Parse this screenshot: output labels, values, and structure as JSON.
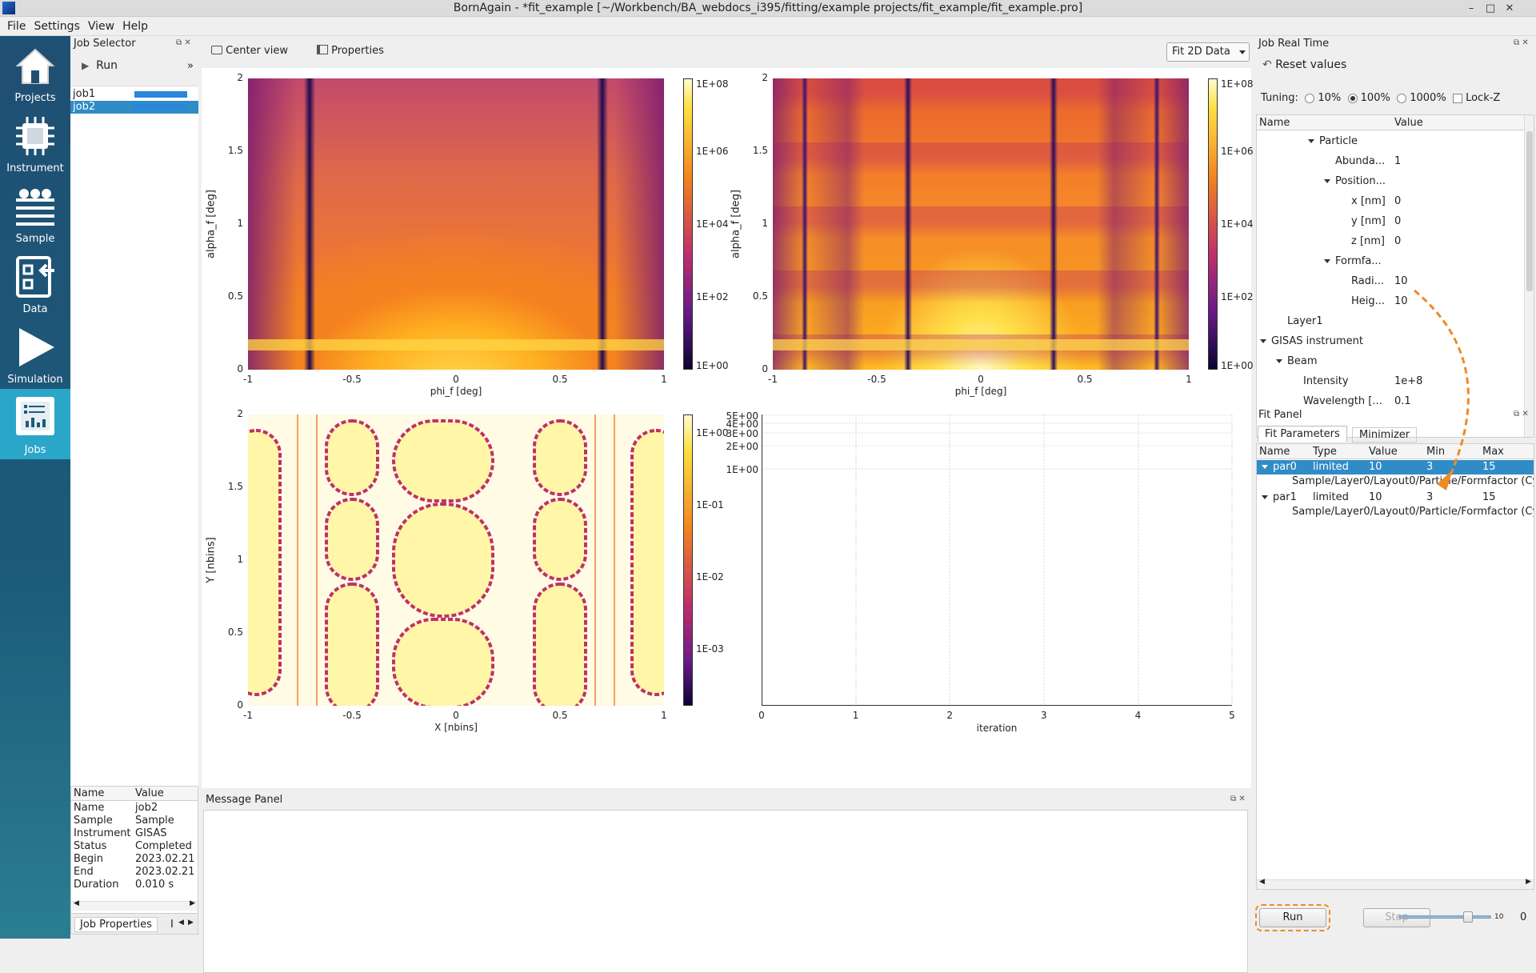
{
  "window": {
    "title": "BornAgain - *fit_example [~/Workbench/BA_webdocs_i395/fitting/example projects/fit_example/fit_example.pro]",
    "min": "–",
    "max": "□",
    "close": "✕"
  },
  "menu": [
    "File",
    "Settings",
    "View",
    "Help"
  ],
  "nav": [
    {
      "label": "Projects",
      "icon": "house-icon"
    },
    {
      "label": "Instrument",
      "icon": "chip-icon"
    },
    {
      "label": "Sample",
      "icon": "layers-icon"
    },
    {
      "label": "Data",
      "icon": "import-data-icon"
    },
    {
      "label": "Simulation",
      "icon": "play-icon"
    },
    {
      "label": "Jobs",
      "icon": "jobs-chart-icon"
    }
  ],
  "job_selector": {
    "title": "Job Selector",
    "run_label": "Run",
    "more": "»",
    "jobs": [
      {
        "name": "job1",
        "progress": 1.0
      },
      {
        "name": "job2",
        "progress": 1.0
      }
    ],
    "selected": "job2"
  },
  "job_properties": {
    "headers": [
      "Name",
      "Value"
    ],
    "rows": [
      [
        "Name",
        "job2"
      ],
      [
        "Sample",
        "Sample"
      ],
      [
        "Instrument",
        "GISAS"
      ],
      [
        "Status",
        "Completed"
      ],
      [
        "Begin",
        "2023.02.21"
      ],
      [
        "End",
        "2023.02.21"
      ],
      [
        "Duration",
        "0.010 s"
      ]
    ],
    "tab_label": "Job Properties",
    "tab2_label": "I"
  },
  "center_toolbar": {
    "center_view": "Center view",
    "properties": "Properties",
    "mode_select": "Fit 2D Data"
  },
  "plots": {
    "real": {
      "xlabel": "phi_f [deg]",
      "ylabel": "alpha_f [deg]",
      "xticks": [
        "-1",
        "-0.5",
        "0",
        "0.5",
        "1"
      ],
      "yticks": [
        "0",
        "0.5",
        "1",
        "1.5",
        "2"
      ],
      "cbticks": [
        "1E+08",
        "1E+06",
        "1E+04",
        "1E+02",
        "1E+00"
      ]
    },
    "sim": {
      "xlabel": "phi_f [deg]",
      "ylabel": "alpha_f [deg]",
      "xticks": [
        "-1",
        "-0.5",
        "0",
        "0.5",
        "1"
      ],
      "yticks": [
        "0",
        "0.5",
        "1",
        "1.5",
        "2"
      ],
      "cbticks": [
        "1E+08",
        "1E+06",
        "1E+04",
        "1E+02",
        "1E+00"
      ]
    },
    "diff": {
      "xlabel": "X [nbins]",
      "ylabel": "Y [nbins]",
      "xticks": [
        "-1",
        "-0.5",
        "0",
        "0.5",
        "1"
      ],
      "yticks": [
        "0",
        "0.5",
        "1",
        "1.5",
        "2"
      ],
      "cbticks": [
        "1E+00",
        "1E-01",
        "1E-02",
        "1E-03"
      ]
    },
    "progress": {
      "xlabel": "iteration",
      "xticks": [
        "0",
        "1",
        "2",
        "3",
        "4",
        "5"
      ],
      "yticks": [
        "5E+00",
        "4E+00",
        "3E+00",
        "2E+00",
        "1E+00"
      ]
    }
  },
  "message_panel": {
    "title": "Message Panel"
  },
  "job_real_time": {
    "title": "Job Real Time",
    "reset": "Reset values",
    "tuning_label": "Tuning:",
    "tuning_options": [
      "10%",
      "100%",
      "1000%"
    ],
    "tuning_selected": "100%",
    "lockz": "Lock-Z",
    "headers": [
      "Name",
      "Value"
    ],
    "rows": [
      {
        "name": "Particle",
        "value": "",
        "level": 3,
        "expand": true
      },
      {
        "name": "Abunda...",
        "value": "1",
        "level": 4,
        "expand": false
      },
      {
        "name": "Position...",
        "value": "",
        "level": 4,
        "expand": true
      },
      {
        "name": "x [nm]",
        "value": "0",
        "level": 5,
        "expand": false
      },
      {
        "name": "y [nm]",
        "value": "0",
        "level": 5,
        "expand": false
      },
      {
        "name": "z [nm]",
        "value": "0",
        "level": 5,
        "expand": false
      },
      {
        "name": "Formfa...",
        "value": "",
        "level": 4,
        "expand": true
      },
      {
        "name": "Radi...",
        "value": "10",
        "level": 5,
        "expand": false
      },
      {
        "name": "Heig...",
        "value": "10",
        "level": 5,
        "expand": false
      },
      {
        "name": "Layer1",
        "value": "",
        "level": 1,
        "expand": false
      },
      {
        "name": "GISAS instrument",
        "value": "",
        "level": 0,
        "expand": true
      },
      {
        "name": "Beam",
        "value": "",
        "level": 1,
        "expand": true
      },
      {
        "name": "Intensity",
        "value": "1e+8",
        "level": 2,
        "expand": false
      },
      {
        "name": "Wavelength [...",
        "value": "0.1",
        "level": 2,
        "expand": false
      }
    ]
  },
  "fit_panel": {
    "title": "Fit Panel",
    "tabs": [
      "Fit Parameters",
      "Minimizer"
    ],
    "headers": [
      "Name",
      "Type",
      "Value",
      "Min",
      "Max"
    ],
    "params": [
      {
        "name": "par0",
        "type": "limited",
        "value": "10",
        "min": "3",
        "max": "15",
        "link": "Sample/Layer0/Layout0/Particle/Formfactor (Cy",
        "selected": true
      },
      {
        "name": "par1",
        "type": "limited",
        "value": "10",
        "min": "3",
        "max": "15",
        "link": "Sample/Layer0/Layout0/Particle/Formfactor (Cy",
        "selected": false
      }
    ],
    "run": "Run",
    "stop": "Stop",
    "slider_max": "10",
    "slider_value": 0.75,
    "iteration_count": "0"
  },
  "colors": {
    "accent_orange": "#f08a24",
    "selection_blue": "#308cc6",
    "nav_active": "#2aa6c9"
  }
}
